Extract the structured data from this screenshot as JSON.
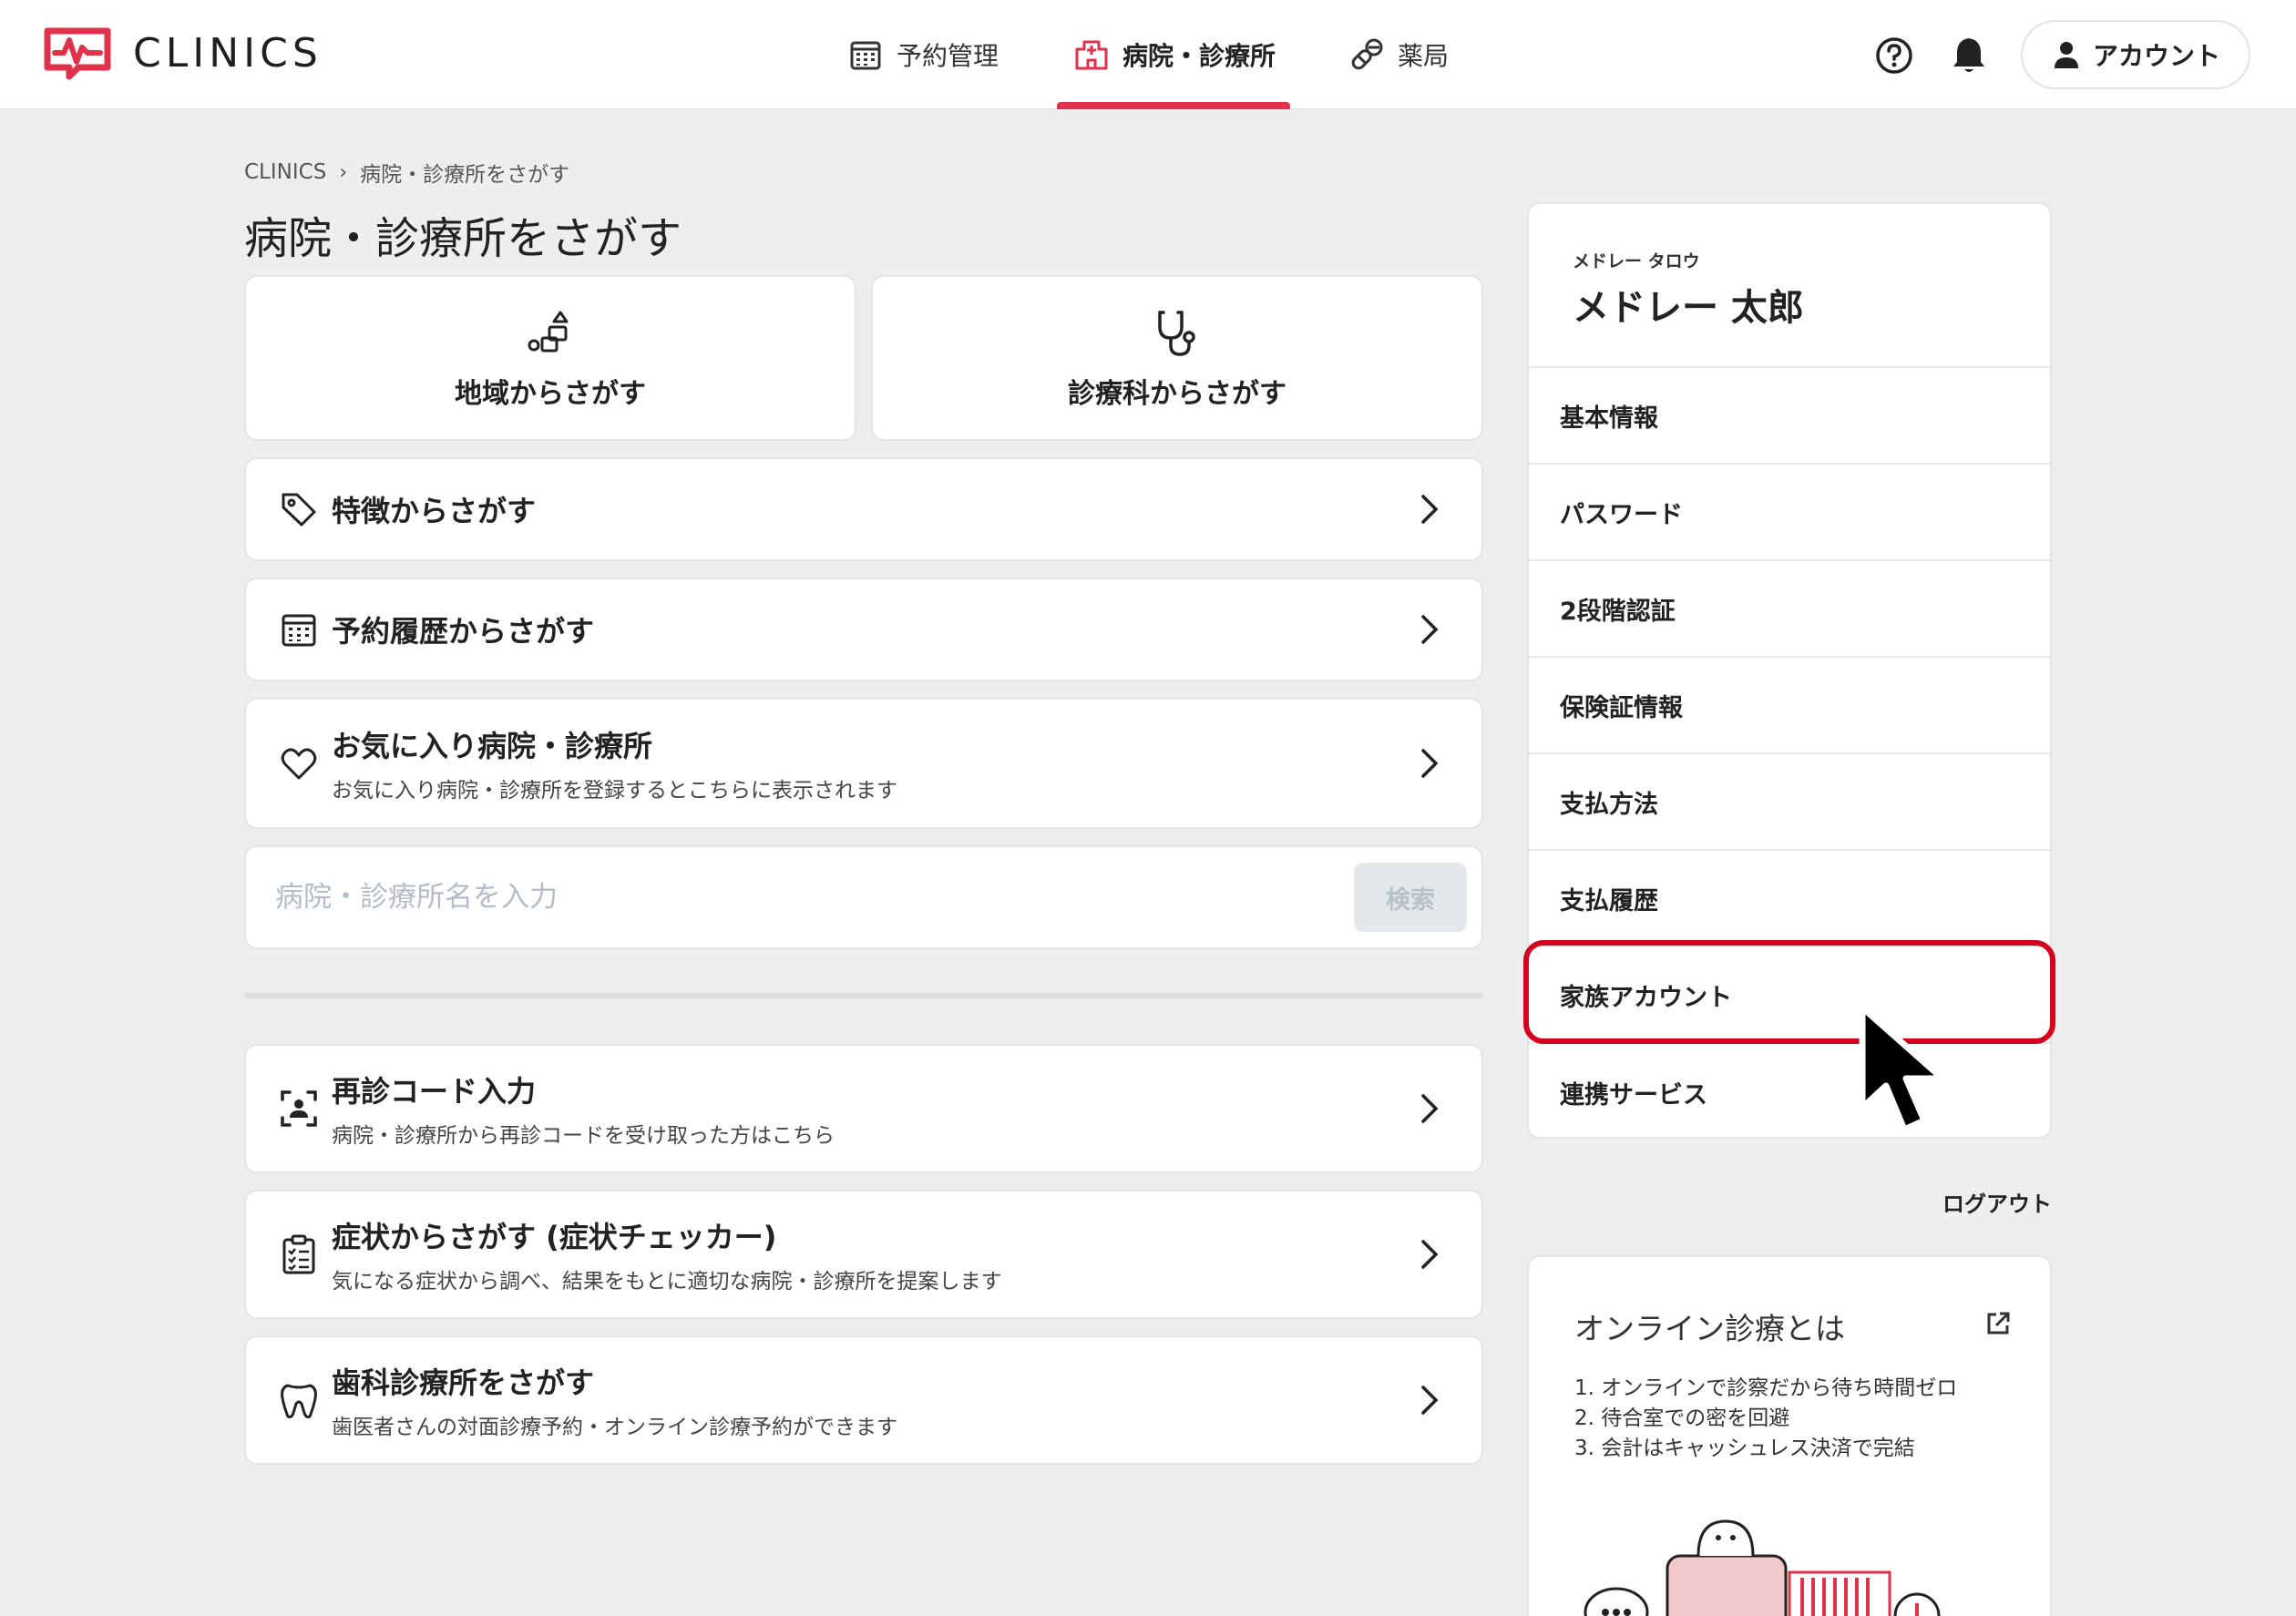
{
  "header": {
    "logo_text": "CLINICS",
    "nav": [
      {
        "label": "予約管理",
        "icon": "calendar-icon"
      },
      {
        "label": "病院・診療所",
        "icon": "hospital-icon",
        "active": true
      },
      {
        "label": "薬局",
        "icon": "pills-icon"
      }
    ],
    "account_label": "アカウント",
    "accent_color": "#e0324a"
  },
  "breadcrumb": {
    "root": "CLINICS",
    "current": "病院・診療所をさがす"
  },
  "page_title": "病院・診療所をさがす",
  "search_options": {
    "area": "地域からさがす",
    "department": "診療科からさがす",
    "features": "特徴からさがす",
    "history": "予約履歴からさがす",
    "favorites_title": "お気に入り病院・診療所",
    "favorites_desc": "お気に入り病院・診療所を登録するとこちらに表示されます"
  },
  "search": {
    "placeholder": "病院・診療所名を入力",
    "button": "検索"
  },
  "extra_links": [
    {
      "title": "再診コード入力",
      "desc": "病院・診療所から再診コードを受け取った方はこちら",
      "icon": "qr-scan-icon"
    },
    {
      "title": "症状からさがす (症状チェッカー)",
      "desc": "気になる症状から調べ、結果をもとに適切な病院・診療所を提案します",
      "icon": "clipboard-icon"
    },
    {
      "title": "歯科診療所をさがす",
      "desc": "歯医者さんの対面診療予約・オンライン診療予約ができます",
      "icon": "tooth-icon"
    }
  ],
  "user": {
    "kana": "メドレー タロウ",
    "name": "メドレー 太郎"
  },
  "account_menu": [
    "基本情報",
    "パスワード",
    "2段階認証",
    "保険証情報",
    "支払方法",
    "支払履歴",
    "家族アカウント",
    "連携サービス"
  ],
  "highlight_color": "#d4001c",
  "logout_label": "ログアウト",
  "online": {
    "title": "オンライン診療とは",
    "points": [
      "1. オンラインで診察だから待ち時間ゼロ",
      "2. 待合室での密を回避",
      "3. 会計はキャッシュレス決済で完結"
    ]
  }
}
